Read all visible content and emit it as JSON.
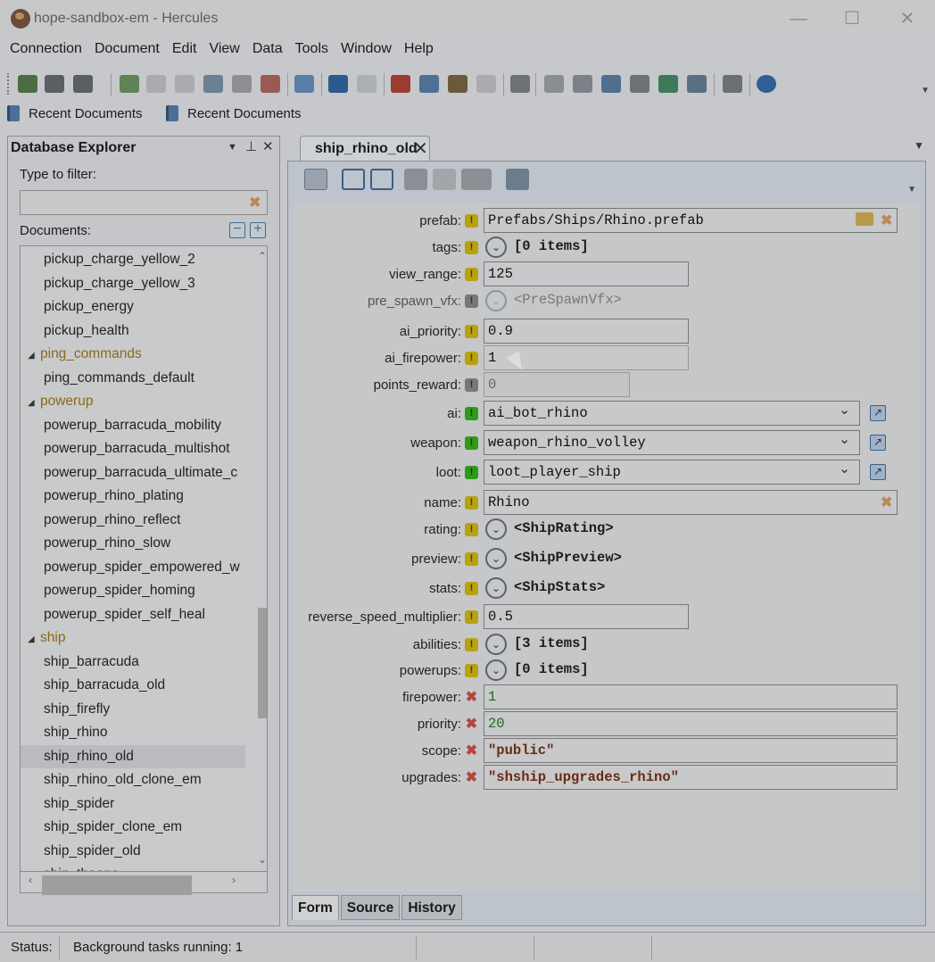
{
  "window": {
    "title": "hope-sandbox-em - Hercules",
    "minimize": "—",
    "maximize": "☐",
    "close": "✕"
  },
  "menu": [
    "Connection",
    "Document",
    "Edit",
    "View",
    "Data",
    "Tools",
    "Window",
    "Help"
  ],
  "recent": [
    {
      "label": "Recent Documents"
    },
    {
      "label": "Recent Documents"
    }
  ],
  "explorer": {
    "title": "Database Explorer",
    "filter_label": "Type to filter:",
    "filter_value": "",
    "documents_label": "Documents:",
    "collapse_all": "−",
    "expand_all": "+",
    "items": [
      {
        "label": "pickup_charge_yellow_2",
        "kind": "doc"
      },
      {
        "label": "pickup_charge_yellow_3",
        "kind": "doc"
      },
      {
        "label": "pickup_energy",
        "kind": "doc"
      },
      {
        "label": "pickup_health",
        "kind": "doc"
      },
      {
        "label": "ping_commands",
        "kind": "cat"
      },
      {
        "label": "ping_commands_default",
        "kind": "doc"
      },
      {
        "label": "powerup",
        "kind": "cat"
      },
      {
        "label": "powerup_barracuda_mobility",
        "kind": "doc"
      },
      {
        "label": "powerup_barracuda_multishot",
        "kind": "doc"
      },
      {
        "label": "powerup_barracuda_ultimate_c",
        "kind": "doc"
      },
      {
        "label": "powerup_rhino_plating",
        "kind": "doc"
      },
      {
        "label": "powerup_rhino_reflect",
        "kind": "doc"
      },
      {
        "label": "powerup_rhino_slow",
        "kind": "doc"
      },
      {
        "label": "powerup_spider_empowered_w",
        "kind": "doc"
      },
      {
        "label": "powerup_spider_homing",
        "kind": "doc"
      },
      {
        "label": "powerup_spider_self_heal",
        "kind": "doc"
      },
      {
        "label": "ship",
        "kind": "cat"
      },
      {
        "label": "ship_barracuda",
        "kind": "doc"
      },
      {
        "label": "ship_barracuda_old",
        "kind": "doc"
      },
      {
        "label": "ship_firefly",
        "kind": "doc"
      },
      {
        "label": "ship_rhino",
        "kind": "doc"
      },
      {
        "label": "ship_rhino_old",
        "kind": "doc",
        "selected": true
      },
      {
        "label": "ship_rhino_old_clone_em",
        "kind": "doc"
      },
      {
        "label": "ship_spider",
        "kind": "doc"
      },
      {
        "label": "ship_spider_clone_em",
        "kind": "doc"
      },
      {
        "label": "ship_spider_old",
        "kind": "doc"
      },
      {
        "label": "ship_theone",
        "kind": "doc"
      }
    ]
  },
  "document": {
    "tab_label": "ship_rhino_old",
    "tab_close": "✕",
    "fields": {
      "prefab": {
        "label": "prefab:",
        "value": "Prefabs/Ships/Rhino.prefab"
      },
      "tags": {
        "label": "tags:",
        "value": "[0 items]"
      },
      "view_range": {
        "label": "view_range:",
        "value": "125"
      },
      "pre_spawn_vfx": {
        "label": "pre_spawn_vfx:",
        "value": "<PreSpawnVfx>"
      },
      "ai_priority": {
        "label": "ai_priority:",
        "value": "0.9"
      },
      "ai_firepower": {
        "label": "ai_firepower:",
        "value": "1"
      },
      "points_reward": {
        "label": "points_reward:",
        "value": "0"
      },
      "ai": {
        "label": "ai:",
        "value": "ai_bot_rhino"
      },
      "weapon": {
        "label": "weapon:",
        "value": "weapon_rhino_volley"
      },
      "loot": {
        "label": "loot:",
        "value": "loot_player_ship"
      },
      "name": {
        "label": "name:",
        "value": "Rhino"
      },
      "rating": {
        "label": "rating:",
        "value": "<ShipRating>"
      },
      "preview": {
        "label": "preview:",
        "value": "<ShipPreview>"
      },
      "stats": {
        "label": "stats:",
        "value": "<ShipStats>"
      },
      "reverse_speed_multiplier": {
        "label": "reverse_speed_multiplier:",
        "value": "0.5"
      },
      "abilities": {
        "label": "abilities:",
        "value": "[3 items]"
      },
      "powerups": {
        "label": "powerups:",
        "value": "[0 items]"
      },
      "firepower": {
        "label": "firepower:",
        "value": "1"
      },
      "priority": {
        "label": "priority:",
        "value": "20"
      },
      "scope": {
        "label": "scope:",
        "value": "\"public\""
      },
      "upgrades": {
        "label": "upgrades:",
        "value": "\"shship_upgrades_rhino\""
      }
    },
    "bottom_tabs": [
      "Form",
      "Source",
      "History"
    ]
  },
  "status": {
    "label": "Status:",
    "text": "Background tasks running: 1"
  },
  "colors": {
    "category": "#8a6a16",
    "required_mark": "#b8a20e",
    "reference_mark": "#2f9a1a",
    "invalid_mark": "#b3463c"
  }
}
